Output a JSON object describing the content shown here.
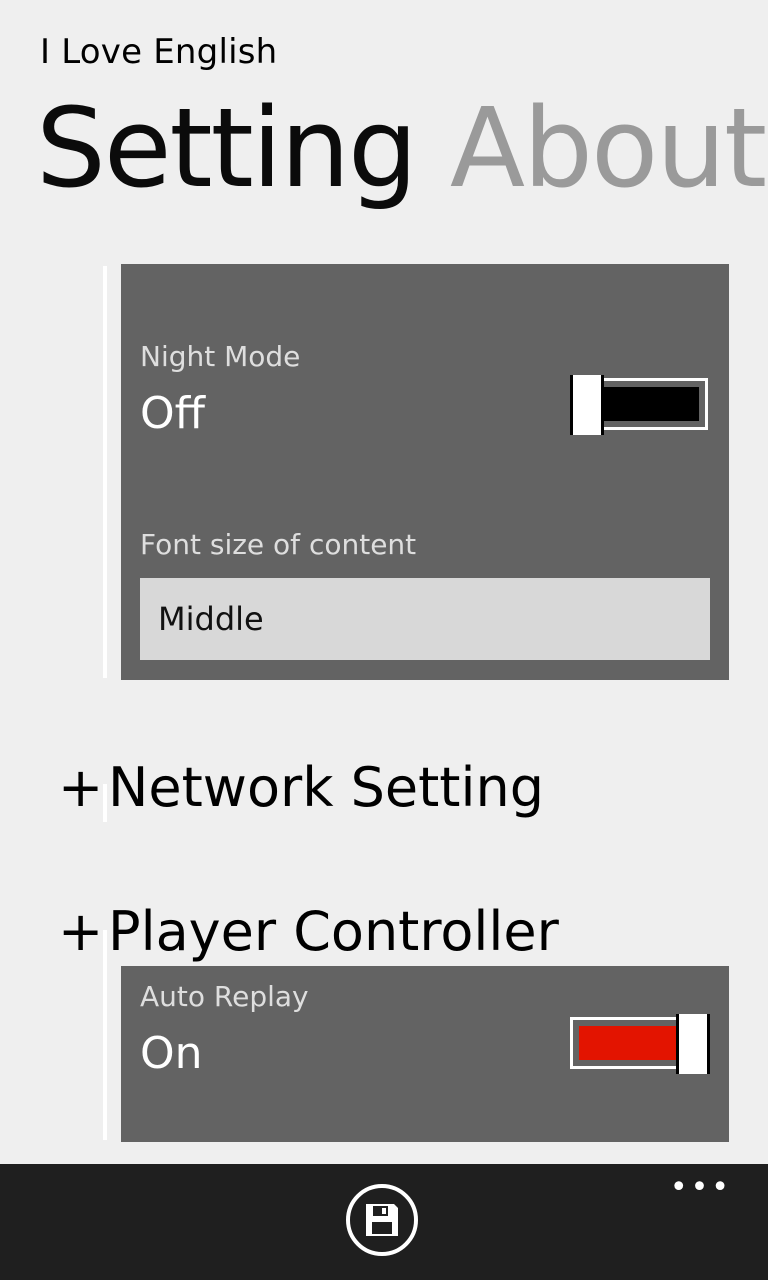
{
  "app": {
    "title": "I Love English"
  },
  "pivot": {
    "tabs": [
      {
        "label": "Setting"
      },
      {
        "label": "About"
      }
    ]
  },
  "display_settings": {
    "night_mode": {
      "label": "Night Mode",
      "value": "Off",
      "on": false
    },
    "font_size": {
      "label": "Font size of content",
      "selected": "Middle"
    }
  },
  "groups": {
    "network": {
      "expander": "+",
      "label": "Network Setting"
    },
    "player": {
      "expander": "+",
      "label": "Player Controller"
    }
  },
  "player_settings": {
    "auto_replay": {
      "label": "Auto Replay",
      "value": "On",
      "on": true
    }
  },
  "appbar": {
    "more": "•••",
    "save_icon": "save-icon"
  },
  "colors": {
    "background": "#efefef",
    "panel": "#636363",
    "toggle_off_fill": "#000000",
    "toggle_on_fill": "#e31400",
    "appbar": "#1f1f1f"
  }
}
